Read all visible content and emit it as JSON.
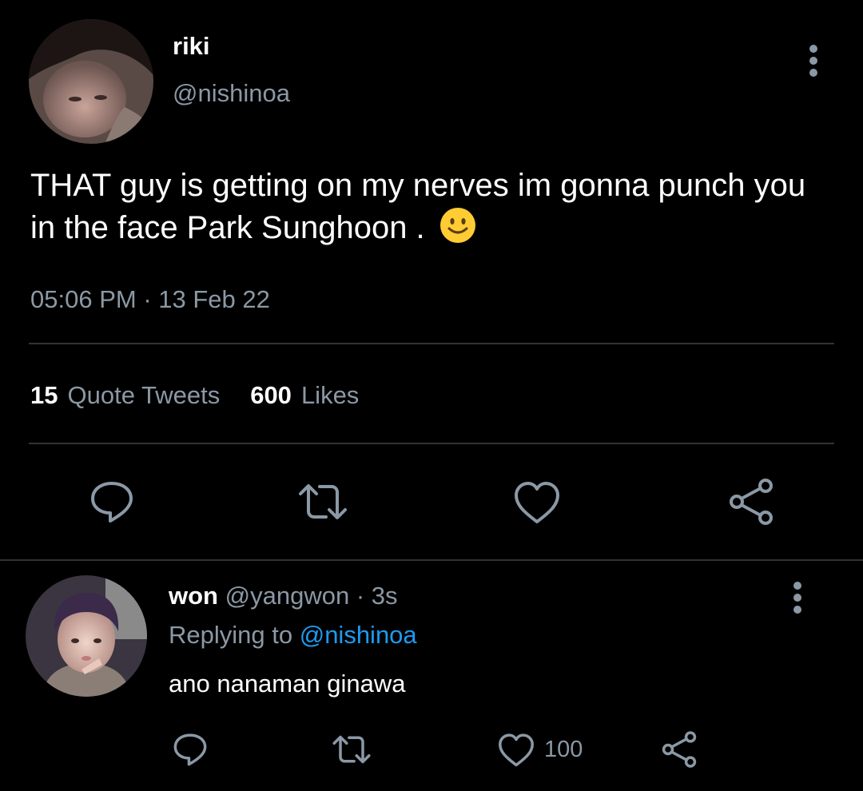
{
  "tweet": {
    "author_name": "riki",
    "author_handle": "@nishinoa",
    "text": "THAT guy is getting on my nerves im gonna punch you in the face Park Sunghoon . ",
    "emoji": "slightly-smiling-face",
    "time": "05:06 PM",
    "separator": "·",
    "date": "13 Feb 22",
    "quote_tweets_count": "15",
    "quote_tweets_label": "Quote Tweets",
    "likes_count": "600",
    "likes_label": "Likes",
    "more_icon": "more-vertical-icon",
    "actions": [
      "reply-icon",
      "retweet-icon",
      "like-icon",
      "share-icon"
    ]
  },
  "reply": {
    "author_name": "won",
    "author_handle": "@yangwon",
    "separator": "·",
    "time": "3s",
    "replying_prefix": "Replying to",
    "replying_to": "@nishinoa",
    "text": "ano nanaman ginawa",
    "like_count": "100",
    "more_icon": "more-vertical-icon",
    "actions": [
      "reply-icon",
      "retweet-icon",
      "like-icon",
      "share-icon"
    ]
  },
  "colors": {
    "background": "#000000",
    "text_primary": "#ffffff",
    "text_secondary": "#8b98a5",
    "divider": "#2f3336",
    "link": "#1d9bf0",
    "emoji_face": "#ffcc33"
  }
}
